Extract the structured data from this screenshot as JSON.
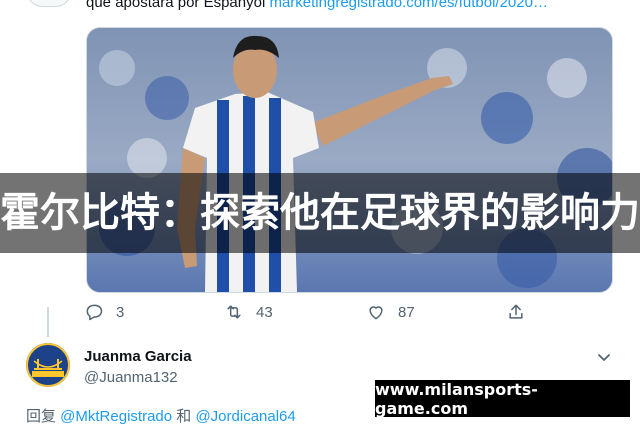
{
  "tweet": {
    "text_prefix": "que apostara por Espanyol ",
    "link": "marketingregistrado.com/es/futbol/2020…"
  },
  "overlay": {
    "title": "霍尔比特：探索他在足球界的影响力",
    "watermark": "www.milansports-game.com"
  },
  "actions": {
    "replies": "3",
    "retweets": "43",
    "likes": "87"
  },
  "reply": {
    "name": "Juanma Garcia",
    "handle": "@Juanma132",
    "reply_prefix": "回复 ",
    "mention_1": "@MktRegistrado",
    "conjunction": " 和 ",
    "mention_2": "@Jordicanal64"
  },
  "icons": [
    "reply-icon",
    "retweet-icon",
    "like-icon",
    "share-icon",
    "chevron-down-icon"
  ],
  "colors": {
    "link": "#1d9bf0",
    "secondary_text": "#536471",
    "overlay_bg": "rgba(0,0,0,0.55)",
    "watermark_bg": "#000000",
    "espanyol_blue": "#1f4fa8"
  }
}
